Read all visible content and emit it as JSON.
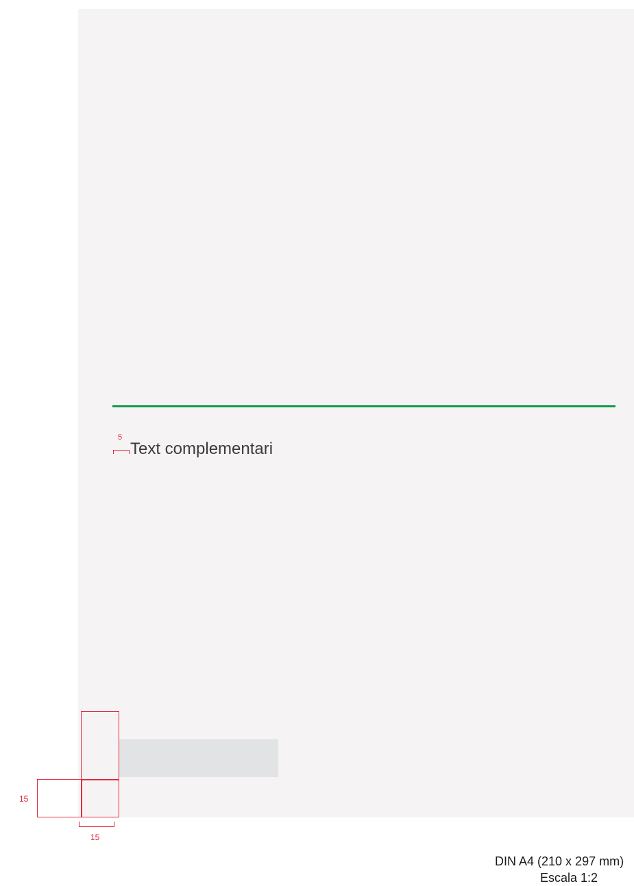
{
  "document": {
    "subtitle": "Text complementari",
    "margin_label": "5",
    "dimensions": {
      "side_label": "15",
      "bottom_label": "15"
    },
    "format": "DIN A4 (210 x 297 mm)",
    "scale": "Escala 1:2"
  },
  "colors": {
    "sheet_background": "#f5f3f4",
    "accent_green": "#0f9a48",
    "guide_red": "#e32b3e",
    "logo_placeholder": "#e2e3e4"
  }
}
